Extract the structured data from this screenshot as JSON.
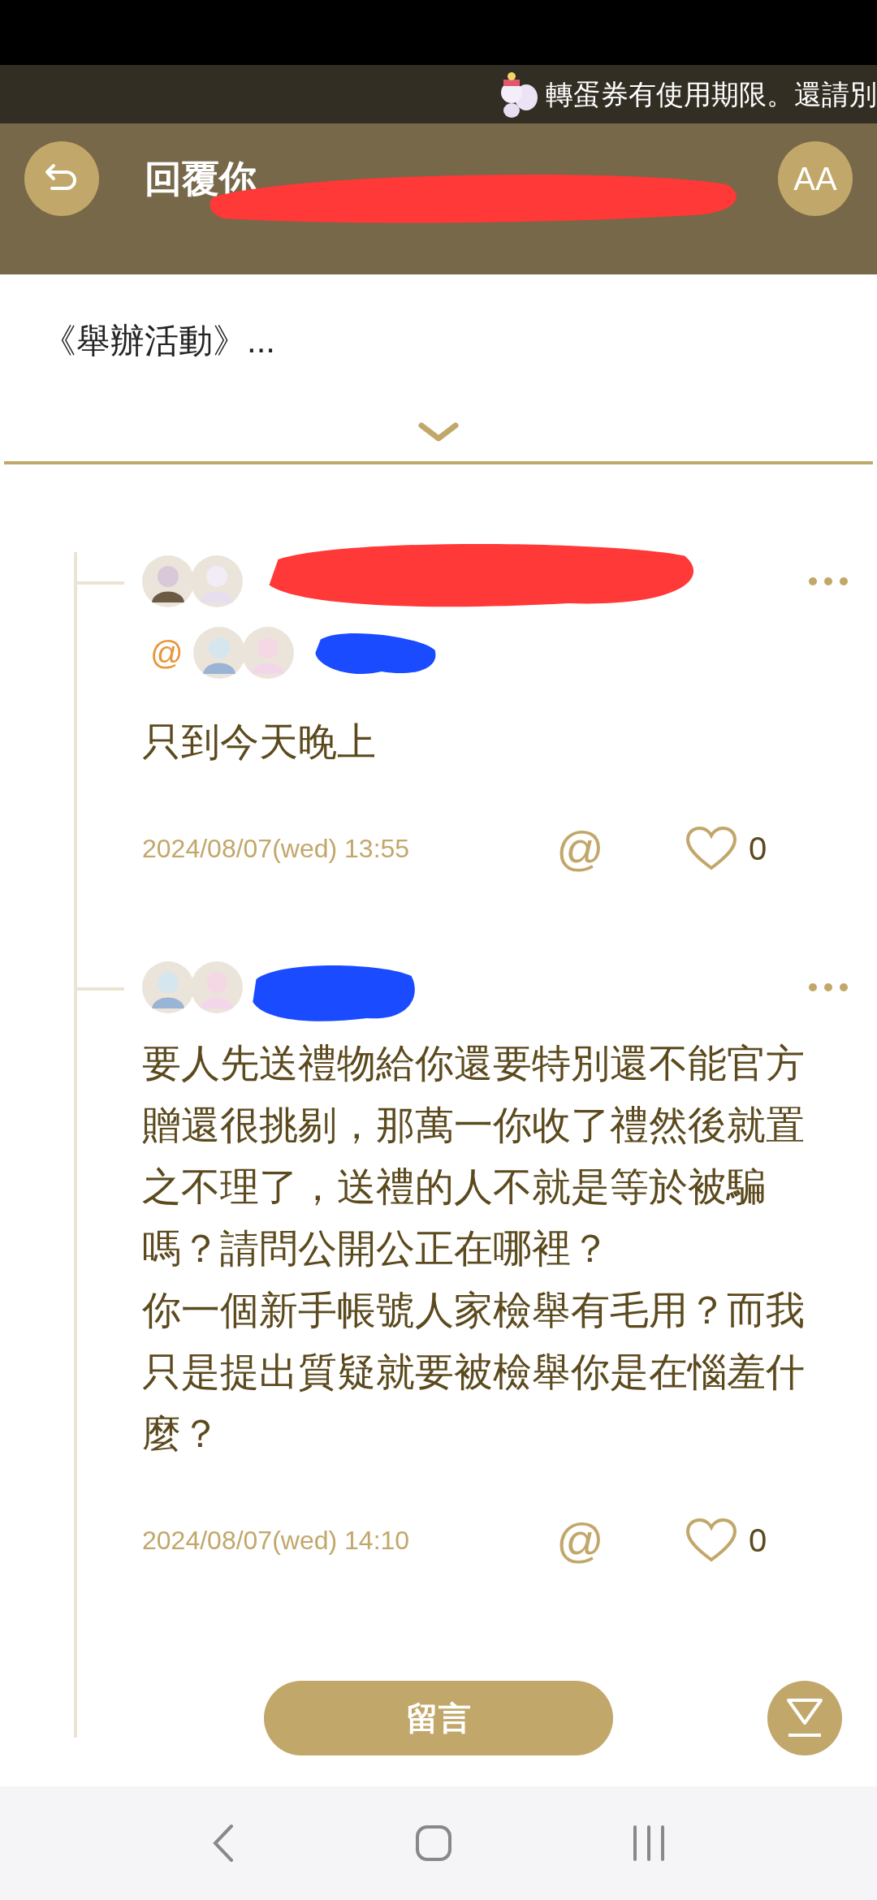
{
  "banner": {
    "text": "轉蛋券有使用期限。還請別"
  },
  "header": {
    "title": "回覆你",
    "font_button": "AA"
  },
  "post_excerpt": "《舉辦活動》...",
  "comments": [
    {
      "mention": {
        "at": "@"
      },
      "body": "只到今天晚上",
      "date": "2024/08/07(wed) 13:55",
      "reply": "@",
      "likes": "0"
    },
    {
      "body": [
        "要人先送禮物給你還要特別還不能官方贈還很挑剔，那萬一你收了禮然後就置之不理了，送禮的人不就是等於被騙嗎？請問公開公正在哪裡？",
        "你一個新手帳號人家檢舉有毛用？而我只是提出質疑就要被檢舉你是在惱羞什麼？"
      ],
      "date": "2024/08/07(wed) 14:10",
      "reply": "@",
      "likes": "0"
    }
  ],
  "comment_button": "留言"
}
